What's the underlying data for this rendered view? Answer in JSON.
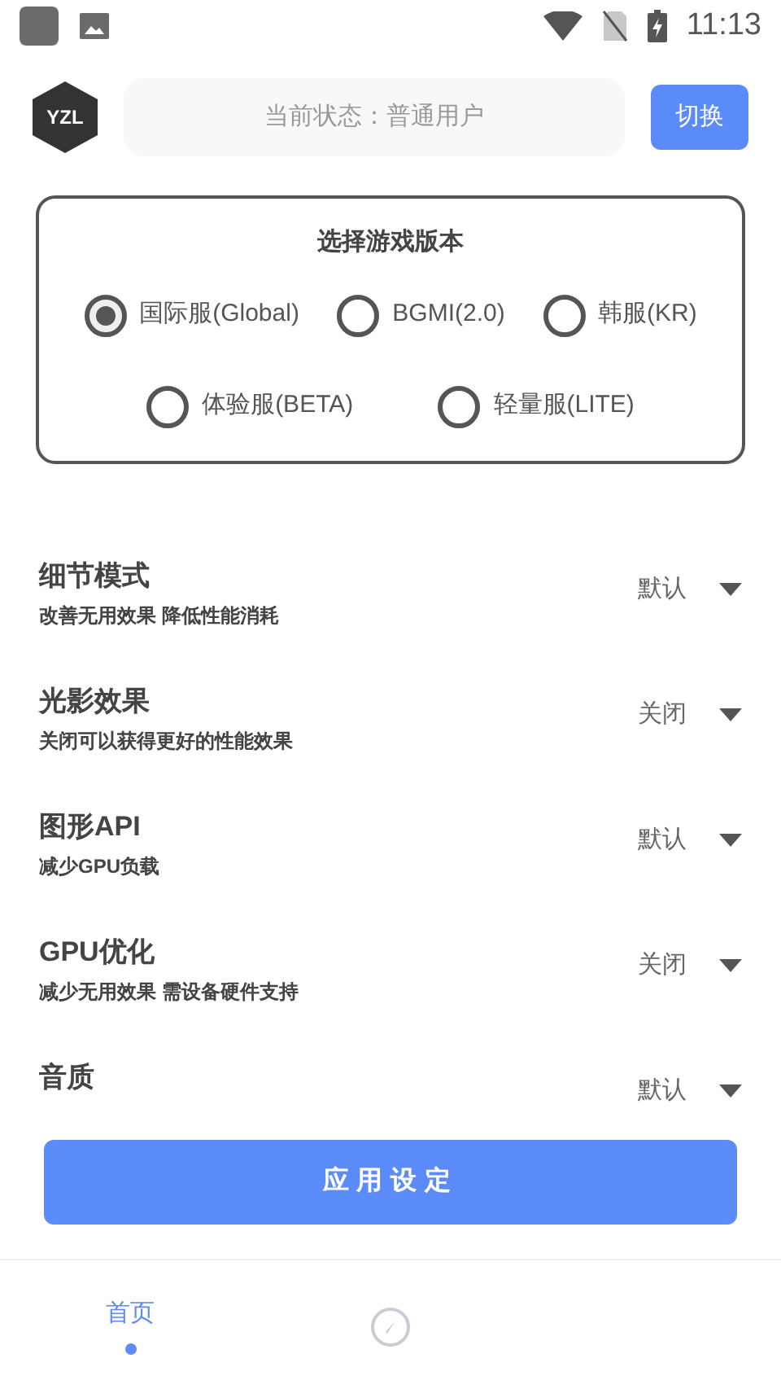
{
  "status_bar": {
    "time": "11:13"
  },
  "header": {
    "logo": "YZL",
    "status_text": "当前状态：普通用户",
    "switch_button": "切换"
  },
  "version_card": {
    "title": "选择游戏版本",
    "option_rows": [
      [
        {
          "label": "国际服(Global)",
          "selected": true
        },
        {
          "label": "BGMI(2.0)",
          "selected": false
        },
        {
          "label": "韩服(KR)",
          "selected": false
        }
      ],
      [
        {
          "label": "体验服(BETA)",
          "selected": false
        },
        {
          "label": "轻量服(LITE)",
          "selected": false
        }
      ]
    ]
  },
  "settings": [
    {
      "title": "细节模式",
      "subtitle": "改善无用效果 降低性能消耗",
      "value": "默认"
    },
    {
      "title": "光影效果",
      "subtitle": "关闭可以获得更好的性能效果",
      "value": "关闭"
    },
    {
      "title": "图形API",
      "subtitle": "减少GPU负载",
      "value": "默认"
    },
    {
      "title": "GPU优化",
      "subtitle": "减少无用效果 需设备硬件支持",
      "value": "关闭"
    },
    {
      "title": "音质",
      "value": "默认"
    }
  ],
  "apply_button": "应用设定",
  "bottom_nav": [
    {
      "kind": "text",
      "label": "首页",
      "selected": true
    },
    {
      "kind": "icon",
      "selected": false
    }
  ]
}
